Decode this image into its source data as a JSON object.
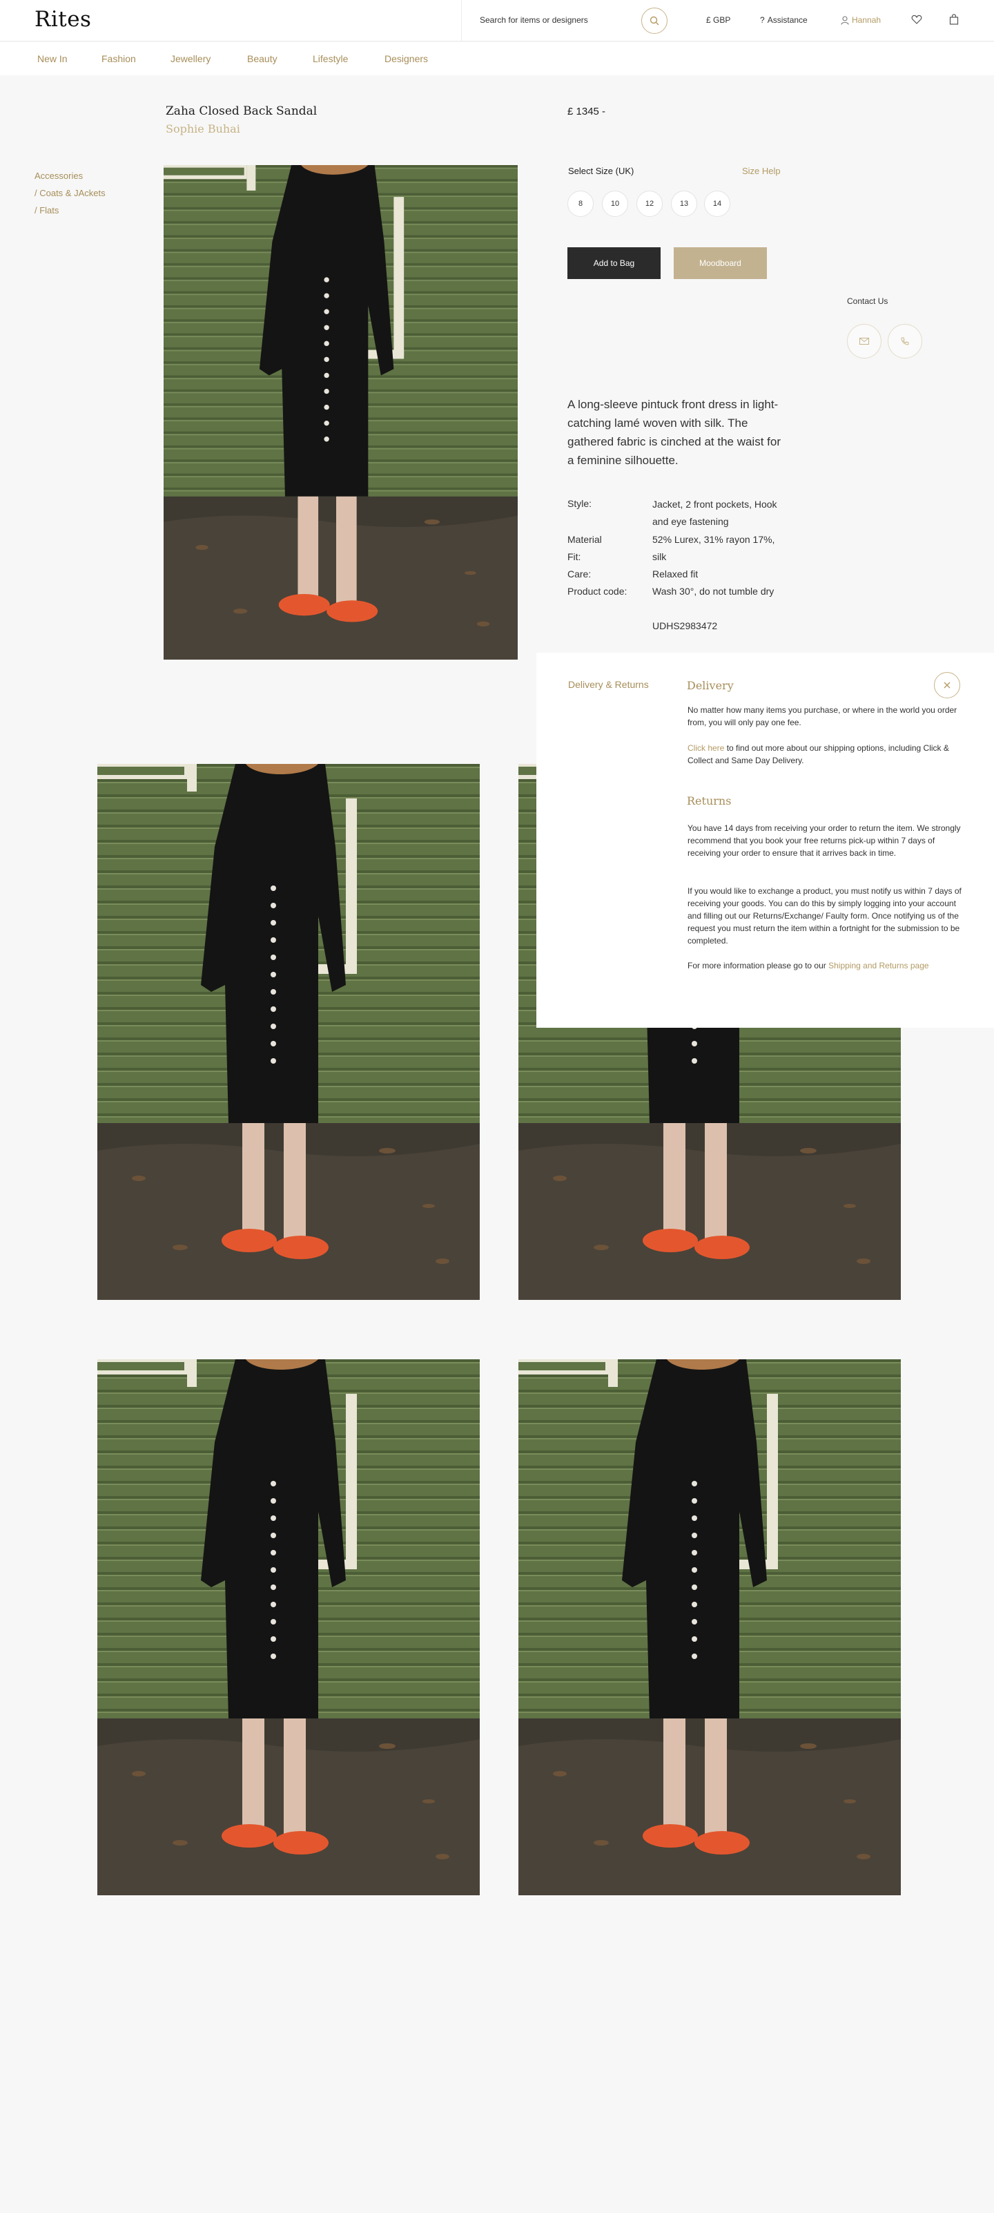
{
  "header": {
    "logo": "Rites",
    "search_placeholder": "Search for items or designers",
    "currency": "£ GBP",
    "assistance": "Assistance",
    "user": "Hannah"
  },
  "nav": [
    "New In",
    "Fashion",
    "Jewellery",
    "Beauty",
    "Lifestyle",
    "Designers"
  ],
  "product": {
    "title": "Zaha Closed Back Sandal",
    "brand": "Sophie Buhai",
    "price": "£ 1345 -",
    "breadcrumb": [
      "Accessories",
      "/ Coats & JAckets",
      "/ Flats"
    ],
    "size_label": "Select Size (UK)",
    "size_help": "Size Help",
    "sizes": [
      "8",
      "10",
      "12",
      "13",
      "14"
    ],
    "add_to_bag": "Add to Bag",
    "moodboard": "Moodboard",
    "contact_label": "Contact Us",
    "description": "A long-sleeve pintuck front dress in light-catching lamé woven with silk. The gathered fabric is cinched at the waist for a feminine silhouette.",
    "specs": [
      {
        "label": "Style:",
        "value": "Jacket, 2 front pockets, Hook and eye fastening"
      },
      {
        "label": "Material",
        "value": "52% Lurex, 31% rayon 17%,"
      },
      {
        "label": "Fit:",
        "value": "silk"
      },
      {
        "label": "Care:",
        "value": "Relaxed fit"
      },
      {
        "label": "Product code:",
        "value": "Wash 30°, do not tumble dry"
      },
      {
        "label": "",
        "value": "UDHS2983472"
      }
    ]
  },
  "delivery_panel": {
    "tab": "Delivery & Returns",
    "delivery_heading": "Delivery",
    "delivery_text": "No matter how many items you purchase, or where in the world you order from, you will only pay one fee.",
    "click_here": "Click here",
    "shipping_text": "to find out more about our shipping options, including Click & Collect and Same Day Delivery.",
    "returns_heading": "Returns",
    "returns_p1": "You have 14 days from receiving your order to return the item. We strongly recommend that you book your free returns pick-up within 7 days of receiving your order to ensure that it arrives back in time.",
    "returns_p2": "If you would like to exchange a product, you must notify us within 7 days of receiving your goods. You can do this by simply logging into your account and filling out our Returns/Exchange/ Faulty form. Once notifying us of the request you must return the item within a fortnight for the submission to be completed.",
    "more_info": "For more information please go to our",
    "more_link": "Shipping and Returns page"
  },
  "colors": {
    "accent": "#a78e5a",
    "button_dark": "#2b2b2b",
    "button_mood": "#c3b290"
  }
}
